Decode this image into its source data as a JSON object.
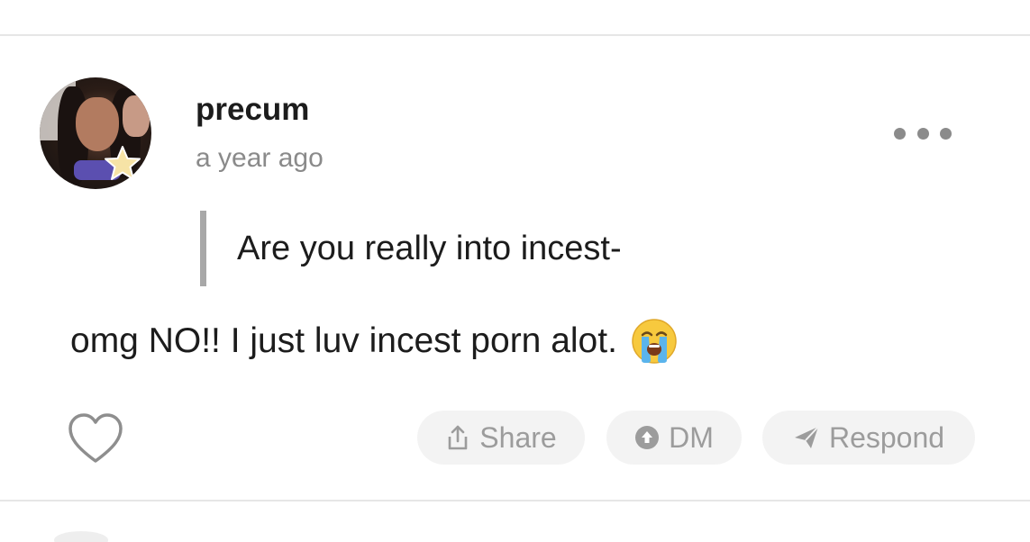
{
  "post": {
    "username": "precum",
    "timestamp": "a year ago",
    "quote": "Are you really into incest-",
    "body": "omg NO!! I just luv incest porn alot.",
    "emoji": "crying-face-emoji"
  },
  "actions": {
    "share_label": "Share",
    "dm_label": "DM",
    "respond_label": "Respond"
  },
  "icons": {
    "more": "more-dots-icon",
    "like": "heart-icon",
    "share": "share-icon",
    "dm": "dm-icon",
    "respond": "paper-plane-icon",
    "badge": "star-icon"
  },
  "colors": {
    "text": "#1c1c1c",
    "muted": "#8a8a8a",
    "pill_bg": "#f3f3f3",
    "pill_text": "#9c9c9c",
    "quote_bar": "#a8a8a8"
  }
}
